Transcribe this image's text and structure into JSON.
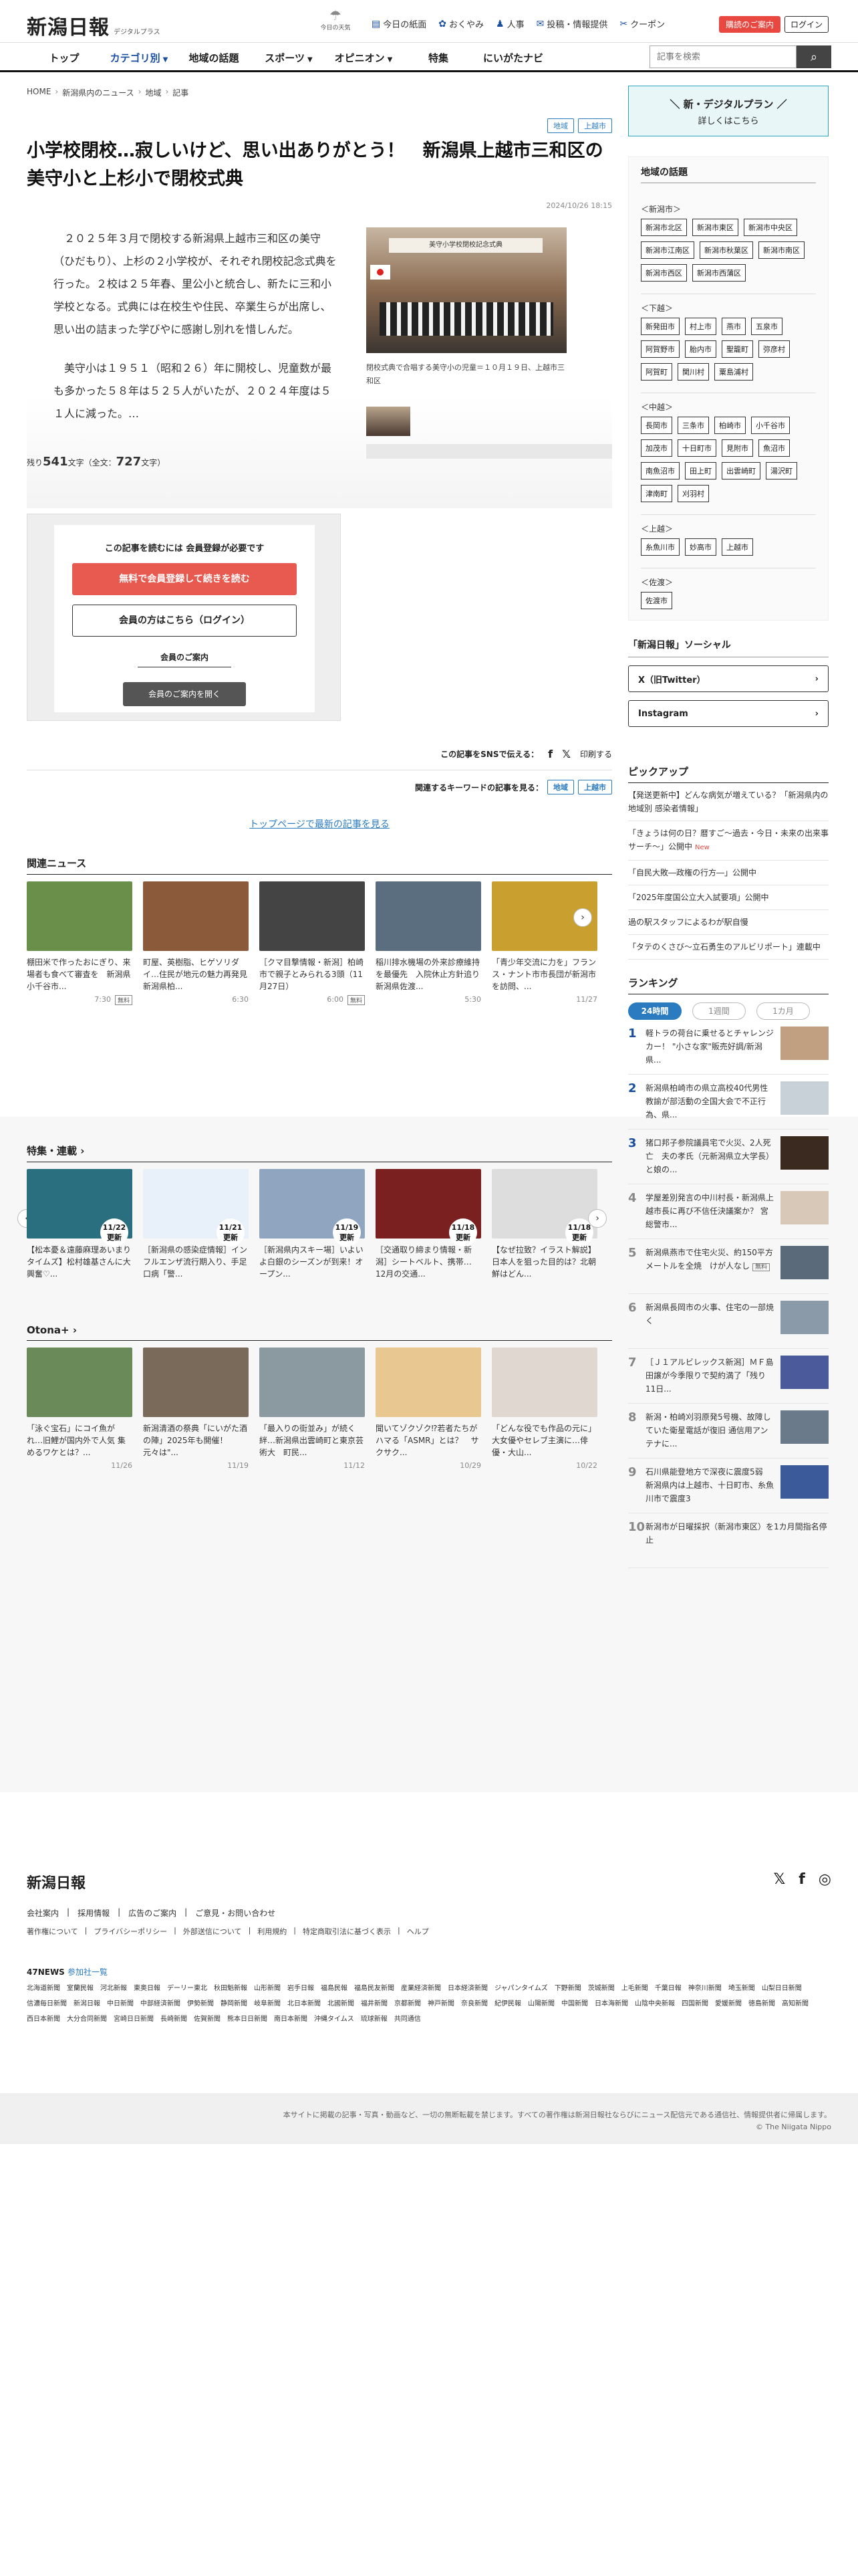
{
  "header": {
    "logo": "新潟日報",
    "logo_sub": "デジタルプラス",
    "weather_label": "今日の天気",
    "links": [
      "今日の紙面",
      "おくやみ",
      "人事",
      "投稿・情報提供",
      "クーポン"
    ],
    "guide_button": "購読のご案内",
    "login_button": "ログイン"
  },
  "nav": {
    "items": [
      "トップ",
      "カテゴリ別",
      "地域の話題",
      "スポーツ",
      "オピニオン",
      "特集",
      "にいがたナビ"
    ],
    "search_placeholder": "記事を検索"
  },
  "breadcrumb": [
    "HOME",
    "新潟県内のニュース",
    "地域",
    "記事"
  ],
  "article": {
    "tags": [
      "地域",
      "上越市"
    ],
    "title": "小学校閉校…寂しいけど、思い出ありがとう！　新潟県上越市三和区の美守小と上杉小で閉校式典",
    "date": "2024/10/26 18:15",
    "p1": "２０２５年３月で閉校する新潟県上越市三和区の美守（ひだもり）、上杉の２小学校が、それぞれ閉校記念式典を行った。２校は２５年春、里公小と統合し、新たに三和小学校となる。式典には在校生や住民、卒業生らが出席し、思い出の詰まった学びやに感謝し別れを惜しんだ。",
    "p2": "美守小は１９５１（昭和２６）年に開校し、児童数が最も多かった５８年は５２５人がいたが、２０２４年度は５１人に減った。…",
    "photo_banner": "美守小学校閉校記念式典",
    "caption": "閉校式典で合唱する美守小の児童＝１０月１９日、上越市三和区",
    "remain_label": "残り",
    "remain_count": "541",
    "remain_unit": "文字（全文：",
    "total_count": "727",
    "total_unit": "文字）"
  },
  "paywall": {
    "head": "この記事を読むには 会員登録が必要です",
    "register": "無料で会員登録して続きを読む",
    "login": "会員の方はこちら（ログイン）",
    "guide": "会員のご案内",
    "open": "会員のご案内を開く"
  },
  "share": {
    "label": "この記事をSNSで伝える：",
    "print": "印刷する",
    "kw_label": "関連するキーワードの記事を見る：",
    "top_link": "トップページで最新の記事を見る"
  },
  "related": {
    "title": "関連ニュース",
    "items": [
      {
        "text": "棚田米で作ったおにぎり、来場者も食べて審査を　新潟県小千谷市...",
        "time": "7:30",
        "free": "無料",
        "color": "#6a8f4a"
      },
      {
        "text": "町屋、英樹脂、ヒゲソリダイ…住民が地元の魅力再発見　新潟県柏...",
        "time": "6:30",
        "free": "",
        "color": "#8a5a3a"
      },
      {
        "text": "［クマ目撃情報・新潟］柏崎市で親子とみられる3頭（11月27日）",
        "time": "6:00",
        "free": "無料",
        "color": "#444"
      },
      {
        "text": "稲川排水機場の外来診療維持を最優先　入院休止方針追り新潟県佐渡...",
        "time": "5:30",
        "free": "",
        "color": "#5a6e80"
      },
      {
        "text": "「青少年交流に力を」フランス・ナント市市長団が新潟市を訪問、...",
        "time": "11/27",
        "free": "",
        "color": "#c9a030"
      }
    ]
  },
  "features": {
    "title": "特集・連載",
    "items": [
      {
        "text": "【松本憂＆遠藤麻理あいまりタイムズ】松村雄基さんに大興奮♡...",
        "badge": "11/22\n更新",
        "color": "#2a6f7f"
      },
      {
        "text": "［新潟県の感染症情報］インフルエンザ流行期入り、手足口病「警...",
        "badge": "11/21\n更新",
        "color": "#e8f0fa"
      },
      {
        "text": "［新潟県内スキー場］いよいよ白銀のシーズンが到来！オープン...",
        "badge": "11/19\n更新",
        "color": "#8fa5c0"
      },
      {
        "text": "［交通取り締まり情報・新潟］シートベルト、携帯…12月の交通...",
        "badge": "11/18\n更新",
        "color": "#7a2020"
      },
      {
        "text": "【なぜ拉致？イラスト解説】日本人を狙った目的は？北朝鮮はどん...",
        "badge": "11/18\n更新",
        "color": "#ddd"
      }
    ]
  },
  "otona": {
    "title": "Otona+",
    "items": [
      {
        "text": "「泳ぐ宝石」にコイ魚が れ…旧鯉が国内外で人気 集めるワケとは？...",
        "date": "11/26",
        "color": "#6a8a5a"
      },
      {
        "text": "新潟清酒の祭典「にいがた酒の陣」2025年も開催！　元々は\"...",
        "date": "11/19",
        "color": "#7a6a5a"
      },
      {
        "text": "「最入りの街並み」が続く絆…新潟県出雲崎町と東京芸術大　町民...",
        "date": "11/12",
        "color": "#8a9aa0"
      },
      {
        "text": "聞いてゾクゾク⁉若者たちがハマる「ASMR」とは？　サクサク...",
        "date": "10/29",
        "color": "#e8c890"
      },
      {
        "text": "「どんな役でも作品の元に」大女優やセレブ主演に…俳優・大山...",
        "date": "10/22",
        "color": "#e0d8d0"
      }
    ]
  },
  "sidebar": {
    "plan_title": "＼ 新・デジタルプラン ／",
    "plan_sub": "詳しくはこちら",
    "topics_title": "地域の話題",
    "groups": [
      {
        "name": "＜新潟市＞",
        "chips": [
          "新潟市北区",
          "新潟市東区",
          "新潟市中央区",
          "新潟市江南区",
          "新潟市秋葉区",
          "新潟市南区",
          "新潟市西区",
          "新潟市西蒲区"
        ]
      },
      {
        "name": "＜下越＞",
        "chips": [
          "新発田市",
          "村上市",
          "燕市",
          "五泉市",
          "阿賀野市",
          "胎内市",
          "聖籠町",
          "弥彦村",
          "阿賀町",
          "関川村",
          "粟島浦村"
        ]
      },
      {
        "name": "＜中越＞",
        "chips": [
          "長岡市",
          "三条市",
          "柏崎市",
          "小千谷市",
          "加茂市",
          "十日町市",
          "見附市",
          "魚沼市",
          "南魚沼市",
          "田上町",
          "出雲崎町",
          "湯沢町",
          "津南町",
          "刈羽村"
        ]
      },
      {
        "name": "＜上越＞",
        "chips": [
          "糸魚川市",
          "妙高市",
          "上越市"
        ]
      },
      {
        "name": "＜佐渡＞",
        "chips": [
          "佐渡市"
        ]
      }
    ],
    "social_title": "「新潟日報」ソーシャル",
    "social": [
      "X（旧Twitter）",
      "Instagram"
    ],
    "pickup_title": "ピックアップ",
    "pickup": [
      {
        "text": "【発送更新中】どんな病気が増えている？「新潟県内の地域別 感染者情報」",
        "new": ""
      },
      {
        "text": "「きょうは何の日？暦すご〜過去・今日・未来の出来事サーチ〜」公開中",
        "new": "New"
      },
      {
        "text": "「自民大敗―政権の行方―」公開中",
        "new": ""
      },
      {
        "text": "「2025年度国公立大入試要項」公開中",
        "new": ""
      },
      {
        "text": "過の駅スタッフによるわが駅自慢",
        "new": ""
      },
      {
        "text": "「タテのくさび〜立石勇生のアルビリポート」連載中",
        "new": ""
      }
    ],
    "ranking_title": "ランキング",
    "ranking_tabs": [
      "24時間",
      "1週間",
      "1カ月"
    ],
    "ranking": [
      {
        "no": "1",
        "text": "軽トラの荷台に乗せるとチャレンジカー！ \"小さな家\"販売好調/新潟県...",
        "color": "#c0a080"
      },
      {
        "no": "2",
        "text": "新潟県柏崎市の県立高校40代男性教諭が部活動の全国大会で不正行為、県...",
        "color": "#c8d0d8"
      },
      {
        "no": "3",
        "text": "猪口邦子参院議員宅で火災、2人死亡　夫の孝氏（元新潟県立大学長）と娘の...",
        "color": "#3a2a20"
      },
      {
        "no": "4",
        "text": "学屋差別発言の中川村長・新潟県上越市長に再び不信任決議案か？ 宮総警市...",
        "color": "#d8c8b8"
      },
      {
        "no": "5",
        "text": "新潟県燕市で住宅火災、約150平方メートルを全焼　けが人なし",
        "free": "無料",
        "color": "#5a6a7a"
      },
      {
        "no": "6",
        "text": "新潟県長岡市の火事、住宅の一部焼く",
        "color": "#8a9aa8"
      },
      {
        "no": "7",
        "text": "［Ｊ１アルビレックス新潟］ＭＦ島田譲が今季限りで契約満了「残り11日...",
        "color": "#4a5a9a"
      },
      {
        "no": "8",
        "text": "新潟・柏崎刈羽原発5号機、故障していた衛星電話が復旧 通信用アンテナに...",
        "color": "#6a7a8a"
      },
      {
        "no": "9",
        "text": "石川県能登地方で深夜に震度5弱　新潟県内は上越市、十日町市、糸魚川市で震度3",
        "color": "#3a5a9a"
      },
      {
        "no": "10",
        "text": "新潟市が日曜採択（新潟市東区）を1カ月間指名停止",
        "color": ""
      }
    ]
  },
  "footer": {
    "logo": "新潟日報",
    "links": [
      "会社案内",
      "採用情報",
      "広告のご案内",
      "ご意見・お問い合わせ"
    ],
    "links2": [
      "著作権について",
      "プライバシーポリシー",
      "外部送信について",
      "利用規約",
      "特定商取引法に基づく表示",
      "ヘルプ"
    ],
    "news47": "47NEWS",
    "news47_sub": "参加社一覧",
    "papers": [
      "北海道新聞",
      "室蘭民報",
      "河北新報",
      "東奥日報",
      "デーリー東北",
      "秋田魁新報",
      "山形新聞",
      "岩手日報",
      "福島民報",
      "福島民友新聞",
      "産業経済新聞",
      "日本経済新聞",
      "ジャパンタイムズ",
      "下野新聞",
      "茨城新聞",
      "上毛新聞",
      "千葉日報",
      "神奈川新聞",
      "埼玉新聞",
      "山梨日日新聞",
      "信濃毎日新聞",
      "新潟日報",
      "中日新聞",
      "中部経済新聞",
      "伊勢新聞",
      "静岡新聞",
      "岐阜新聞",
      "北日本新聞",
      "北國新聞",
      "福井新聞",
      "京都新聞",
      "神戸新聞",
      "奈良新聞",
      "紀伊民報",
      "山陽新聞",
      "中国新聞",
      "日本海新聞",
      "山陰中央新報",
      "四国新聞",
      "愛媛新聞",
      "徳島新聞",
      "高知新聞",
      "西日本新聞",
      "大分合同新聞",
      "宮崎日日新聞",
      "長崎新聞",
      "佐賀新聞",
      "熊本日日新聞",
      "南日本新聞",
      "沖縄タイムス",
      "琉球新報",
      "共同通信"
    ],
    "copy1": "本サイトに掲載の記事・写真・動画など、一切の無断転載を禁じます。すべての著作権は新潟日報社ならびにニュース配信元である通信社、情報提供者に帰属します。",
    "copy2": "© The Niigata Nippo"
  }
}
